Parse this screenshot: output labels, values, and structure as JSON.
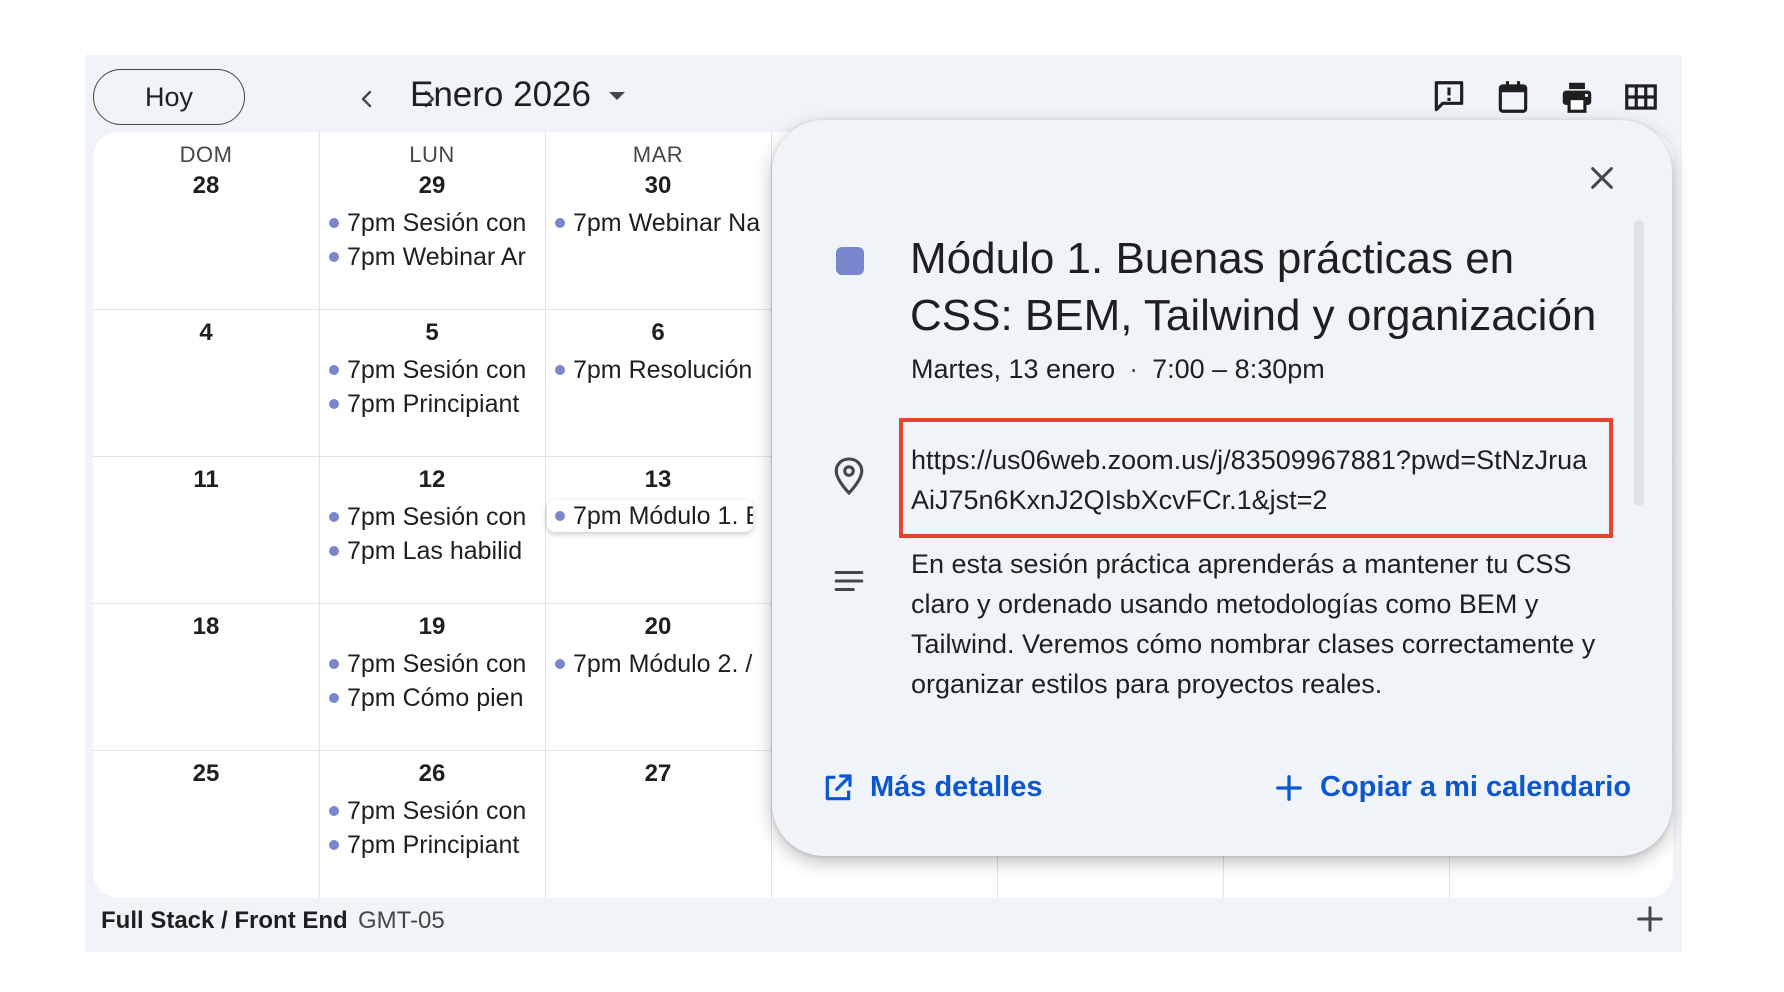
{
  "toolbar": {
    "today_label": "Hoy",
    "prev_icon": "chevron-left-icon",
    "next_icon": "chevron-right-icon",
    "month_label": "Enero 2026",
    "icons": [
      "feedback-icon",
      "calendar-icon",
      "print-icon",
      "grid-icon"
    ]
  },
  "calendar": {
    "weekdays": [
      {
        "label": "DOM",
        "date": "28"
      },
      {
        "label": "LUN",
        "date": "29"
      },
      {
        "label": "MAR",
        "date": "30"
      }
    ],
    "weeks": [
      {
        "days": [
          {
            "date": "28",
            "events": []
          },
          {
            "date": "29",
            "events": [
              {
                "time": "7pm",
                "title": "Sesión con"
              },
              {
                "time": "7pm",
                "title": "Webinar Ar"
              }
            ]
          },
          {
            "date": "30",
            "events": [
              {
                "time": "7pm",
                "title": "Webinar Na"
              }
            ]
          }
        ]
      },
      {
        "days": [
          {
            "date": "4",
            "events": []
          },
          {
            "date": "5",
            "events": [
              {
                "time": "7pm",
                "title": "Sesión con"
              },
              {
                "time": "7pm",
                "title": "Principiant"
              }
            ]
          },
          {
            "date": "6",
            "events": [
              {
                "time": "7pm",
                "title": "Resolución"
              }
            ]
          }
        ]
      },
      {
        "days": [
          {
            "date": "11",
            "events": []
          },
          {
            "date": "12",
            "events": [
              {
                "time": "7pm",
                "title": "Sesión con"
              },
              {
                "time": "7pm",
                "title": "Las habilid"
              }
            ]
          },
          {
            "date": "13",
            "events": [
              {
                "time": "7pm",
                "title": "Módulo 1. E"
              }
            ]
          }
        ]
      },
      {
        "days": [
          {
            "date": "18",
            "events": []
          },
          {
            "date": "19",
            "events": [
              {
                "time": "7pm",
                "title": "Sesión con"
              },
              {
                "time": "7pm",
                "title": "Cómo pien"
              }
            ]
          },
          {
            "date": "20",
            "events": [
              {
                "time": "7pm",
                "title": "Módulo 2. /"
              }
            ]
          }
        ]
      },
      {
        "days": [
          {
            "date": "25",
            "events": []
          },
          {
            "date": "26",
            "events": [
              {
                "time": "7pm",
                "title": "Sesión con"
              },
              {
                "time": "7pm",
                "title": "Principiant"
              }
            ]
          },
          {
            "date": "27",
            "events": []
          }
        ]
      }
    ],
    "event_color": "#7986cb"
  },
  "footer": {
    "calendar_name": "Full Stack / Front End",
    "timezone": "GMT-05"
  },
  "popup": {
    "title": "Módulo 1. Buenas prácticas en CSS: BEM, Tailwind y organización",
    "date": "Martes, 13 enero",
    "time": "7:00 – 8:30pm",
    "location": "https://us06web.zoom.us/j/83509967881?pwd=StNzJruaAiJ75n6KxnJ2QIsbXcvFCr.1&jst=2",
    "description": "En esta sesión práctica aprenderás a mantener tu CSS claro y ordenado usando metodologías como BEM y Tailwind. Veremos cómo nombrar clases correctamente y organizar estilos para proyectos reales.",
    "more_details_label": "Más detalles",
    "copy_label": "Copiar a mi calendario",
    "highlight_color": "#e8432f",
    "link_color": "#0b57d0"
  }
}
